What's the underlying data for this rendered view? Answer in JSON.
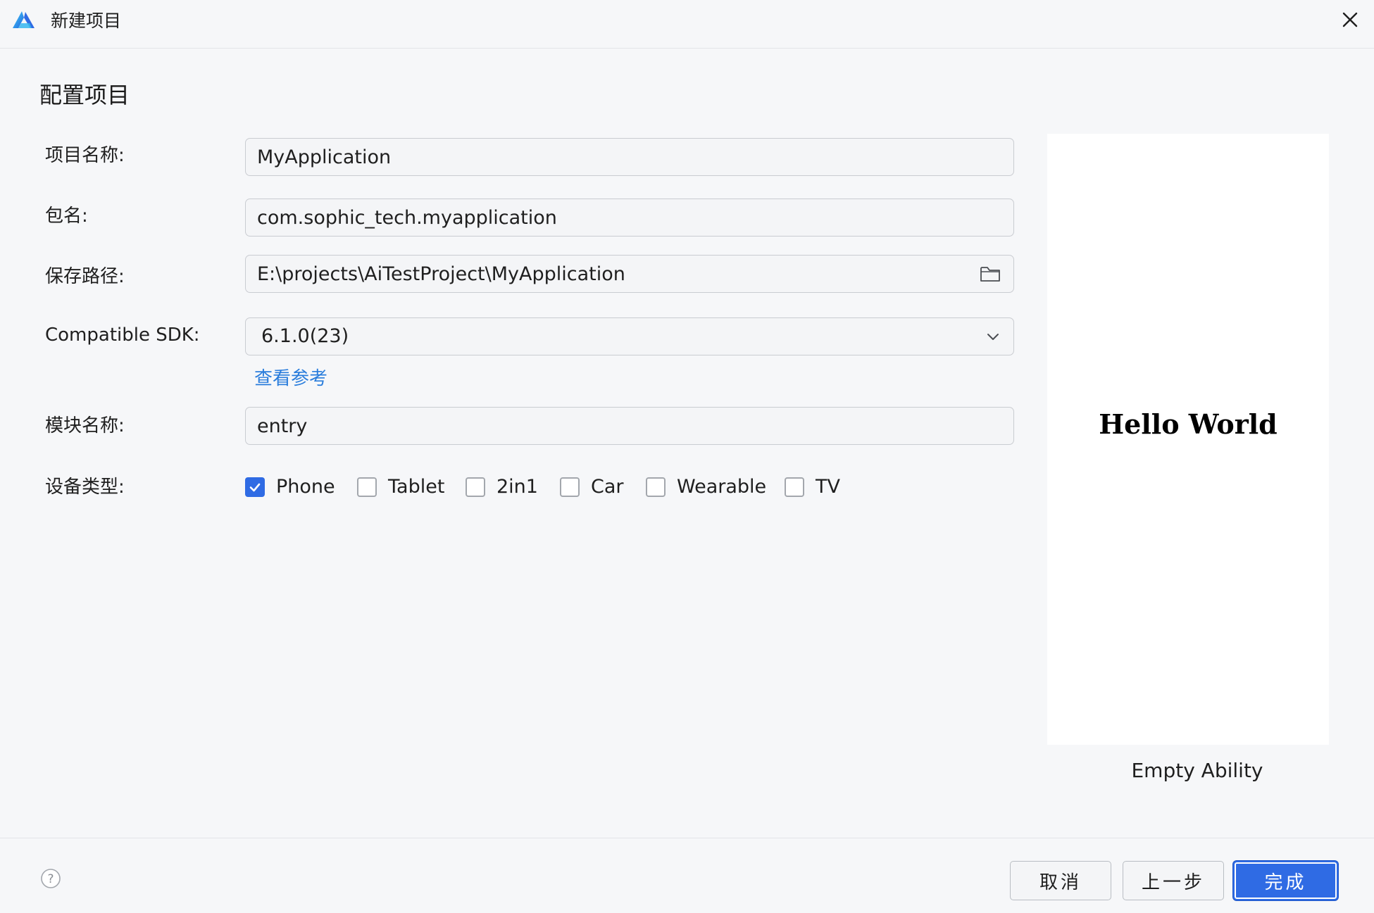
{
  "window": {
    "title": "新建项目",
    "logo_icon": "deveco-logo-icon",
    "close_icon": "close-icon"
  },
  "page": {
    "section_title": "配置项目"
  },
  "form": {
    "project_name": {
      "label": "项目名称:",
      "value": "MyApplication"
    },
    "bundle_name": {
      "label": "包名:",
      "value": "com.sophic_tech.myapplication"
    },
    "save_location": {
      "label": "保存路径:",
      "value": "E:\\projects\\AiTestProject\\MyApplication",
      "icon": "folder-icon"
    },
    "compatible_sdk": {
      "label": "Compatible SDK:",
      "value": "6.1.0(23)",
      "icon": "chevron-down-icon"
    },
    "reference_link": "查看参考",
    "module_name": {
      "label": "模块名称:",
      "value": "entry"
    },
    "device_type": {
      "label": "设备类型:",
      "options": [
        {
          "label": "Phone",
          "checked": true
        },
        {
          "label": "Tablet",
          "checked": false
        },
        {
          "label": "2in1",
          "checked": false
        },
        {
          "label": "Car",
          "checked": false
        },
        {
          "label": "Wearable",
          "checked": false
        },
        {
          "label": "TV",
          "checked": false
        }
      ]
    }
  },
  "preview": {
    "text": "Hello World",
    "template_name": "Empty Ability"
  },
  "footer": {
    "help_icon": "help-icon",
    "cancel_label": "取消",
    "previous_label": "上一步",
    "finish_label": "完成"
  },
  "colors": {
    "accent": "#2f6be4",
    "link": "#2a7ddc",
    "background": "#f6f7f9"
  }
}
